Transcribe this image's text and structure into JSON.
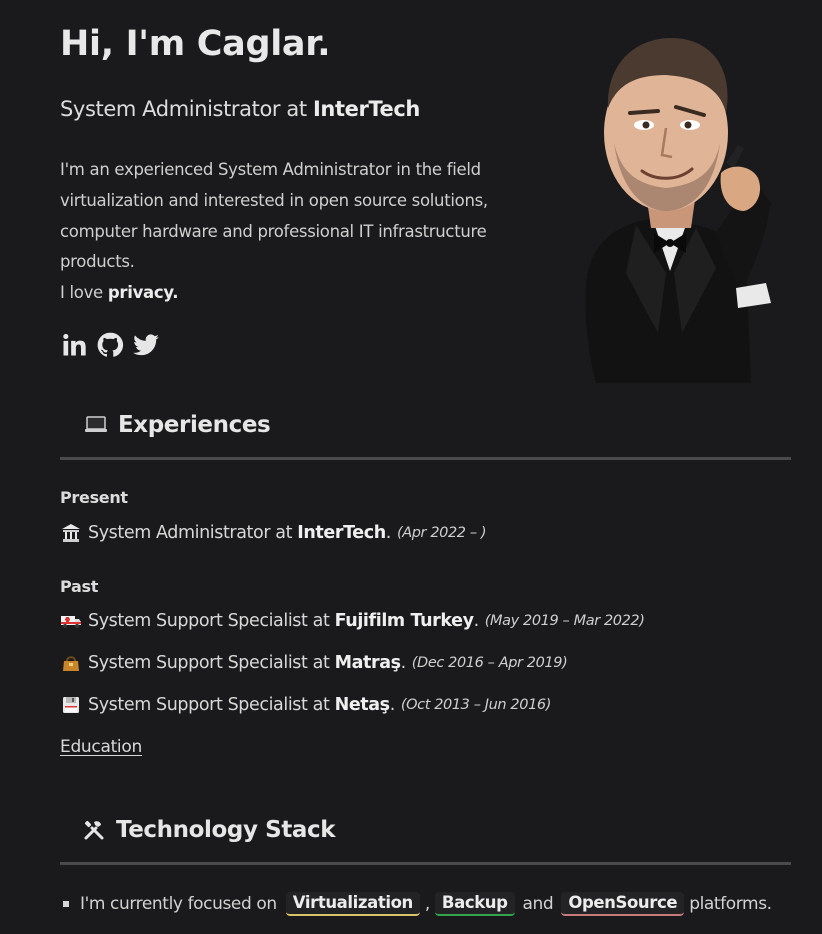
{
  "hero": {
    "title": "Hi, I'm Caglar.",
    "subtitle_prefix": "System Administrator at ",
    "subtitle_company": "InterTech",
    "bio": "I'm an experienced System Administrator in the field virtualization and interested in open source solutions, computer hardware and professional IT infrastructure products.",
    "love_prefix": "I love ",
    "love_word": "privacy.",
    "socials": [
      "linkedin-icon",
      "github-icon",
      "twitter-icon"
    ]
  },
  "experiences": {
    "heading": "Experiences",
    "icon": "laptop-icon",
    "present_label": "Present",
    "past_label": "Past",
    "present": {
      "role": "System Administrator at ",
      "company": "InterTech",
      "dot": ".",
      "dates": "(Apr 2022 – )"
    },
    "past": [
      {
        "icon": "ambulance-icon",
        "role": "System Support Specialist at ",
        "company": "Fujifilm Turkey",
        "dot": ".",
        "dates": "(May 2019 – Mar 2022)"
      },
      {
        "icon": "handbag-icon",
        "role": "System Support Specialist at ",
        "company": "Matraş",
        "dot": ".",
        "dates": "(Dec 2016 – Apr 2019)"
      },
      {
        "icon": "floppy-icon",
        "role": "System Support Specialist at ",
        "company": "Netaş",
        "dot": ".",
        "dates": "(Oct 2013 – Jun 2016)"
      }
    ],
    "education_link": "Education"
  },
  "tech": {
    "heading": "Technology Stack",
    "icon": "tools-icon",
    "line_prefix": "I'm currently focused on",
    "tags": [
      "Virtualization",
      "Backup",
      "OpenSource"
    ],
    "comma": ",",
    "and": "and",
    "suffix": "platforms.",
    "tag_colors": [
      "#d8c26a",
      "#33a44b",
      "#c77a7a"
    ]
  }
}
